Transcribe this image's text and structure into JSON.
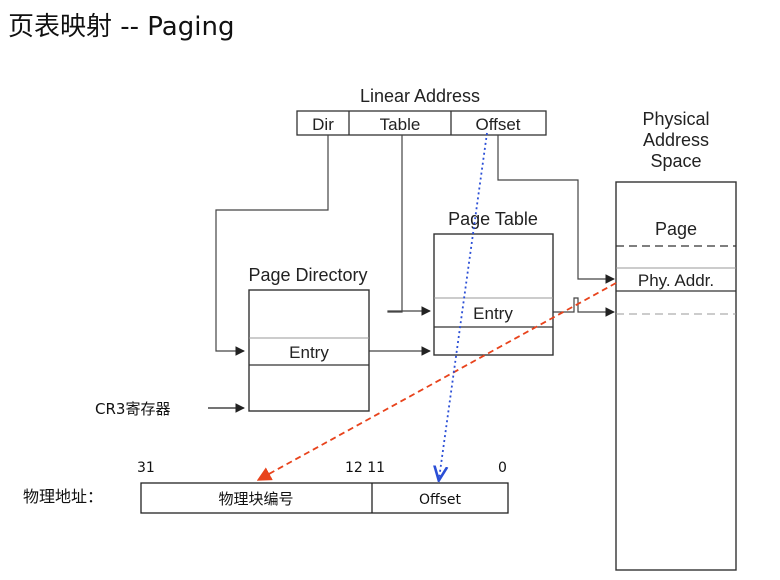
{
  "title": "页表映射 -- Paging",
  "linear_address": {
    "label": "Linear Address",
    "fields": [
      "Dir",
      "Table",
      "Offset"
    ]
  },
  "page_directory": {
    "label": "Page Directory",
    "entry": "Entry"
  },
  "page_table": {
    "label": "Page Table",
    "entry": "Entry"
  },
  "physical_space": {
    "label_lines": [
      "Physical",
      "Address",
      "Space"
    ],
    "page": "Page",
    "phy_addr": "Phy. Addr."
  },
  "cr3_label": "CR3寄存器",
  "physical_address": {
    "label": "物理地址：",
    "bits": {
      "b31": "31",
      "b12_11": "12 11",
      "b0": "0"
    },
    "fields": [
      "物理块编号",
      "Offset"
    ]
  },
  "colors": {
    "red_arrow": "#e8431c",
    "blue_arrow": "#2b4fd6",
    "line": "#333333"
  }
}
